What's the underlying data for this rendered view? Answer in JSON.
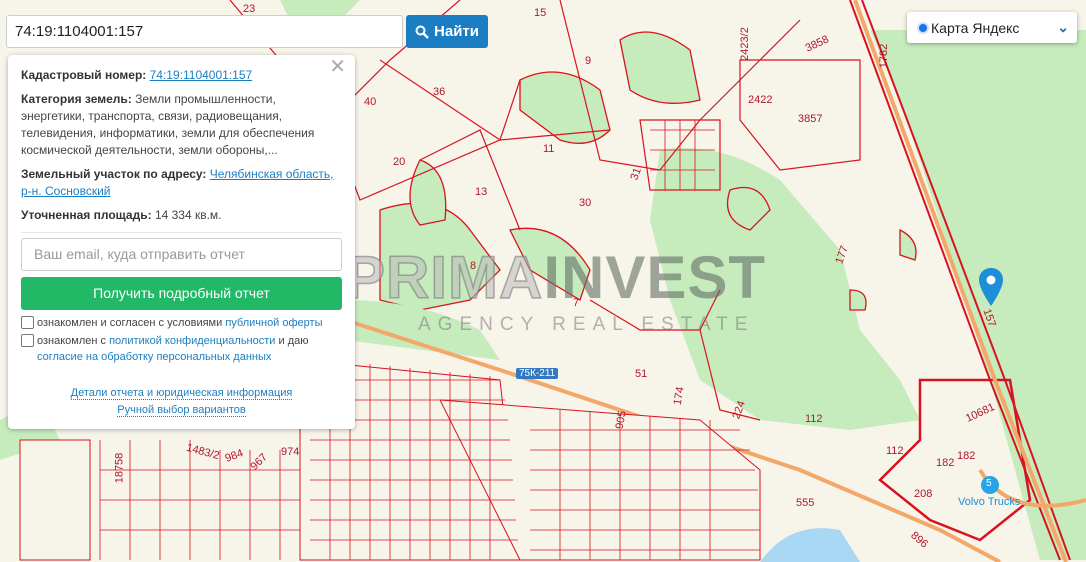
{
  "search": {
    "value": "74:19:1104001:157",
    "button": "Найти"
  },
  "layer": {
    "selected": "Карта Яндекс"
  },
  "panel": {
    "cad_label": "Кадастровый номер:",
    "cad_value": "74:19:1104001:157",
    "cat_label": "Категория земель:",
    "cat_value": "Земли промышленности, энергетики, транспорта, связи, радиовещания, телевидения, информатики, земли для обеспечения космической деятельности, земли обороны,...",
    "addr_label": "Земельный участок по адресу:",
    "addr_value": "Челябинская область, р-н. Сосновский",
    "area_label": "Уточненная площадь:",
    "area_value": "14 334 кв.м.",
    "email_placeholder": "Ваш email, куда отправить отчет",
    "get_button": "Получить подробный отчет",
    "check1_text": "ознакомлен и согласен с условиями ",
    "check1_link": "публичной оферты",
    "check2_text": "ознакомлен с ",
    "check2_link": "политикой конфиденциальности",
    "check2_mid": " и даю ",
    "check2_link2": "согласие на обработку персональных данных",
    "details_link": "Детали отчета и юридическая информация",
    "manual_link": "Ручной выбор вариантов"
  },
  "watermark": {
    "brand_outline": "PRIMA",
    "brand_fill": "INVEST",
    "tagline": "AGENCY REAL ESTATE"
  },
  "map_labels": [
    "23",
    "15",
    "9",
    "3858",
    "2423/2",
    "1782",
    "40",
    "36",
    "2422",
    "3857",
    "11",
    "20",
    "31",
    "13",
    "30",
    "177",
    "8",
    "7",
    "157",
    "51",
    "174",
    "224",
    "112",
    "10681",
    "112",
    "182",
    "182",
    "208",
    "555",
    "896",
    "905",
    "1483/2",
    "984",
    "967",
    "974",
    "18758"
  ],
  "road_badge": "75К-211",
  "poi": {
    "name": "Volvo Trucks",
    "number": "5"
  }
}
